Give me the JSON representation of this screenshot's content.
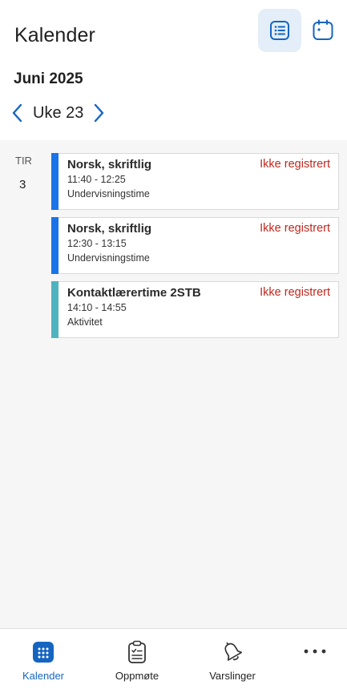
{
  "header": {
    "title": "Kalender",
    "month": "Juni 2025",
    "week": "Uke 23"
  },
  "day": {
    "name": "TIR",
    "number": "3"
  },
  "events": [
    {
      "title": "Norsk, skriftlig",
      "time": "11:40 - 12:25",
      "kind": "Undervisningstime",
      "status": "Ikke registrert",
      "color": "#1a73e8"
    },
    {
      "title": "Norsk, skriftlig",
      "time": "12:30 - 13:15",
      "kind": "Undervisningstime",
      "status": "Ikke registrert",
      "color": "#1a73e8"
    },
    {
      "title": "Kontaktlærertime 2STB",
      "time": "14:10 - 14:55",
      "kind": "Aktivitet",
      "status": "Ikke registrert",
      "color": "#4fb3bf"
    }
  ],
  "tabbar": {
    "tabs": [
      {
        "label": "Kalender",
        "icon": "calendar-icon",
        "active": true
      },
      {
        "label": "Oppmøte",
        "icon": "clipboard-icon",
        "active": false
      },
      {
        "label": "Varslinger",
        "icon": "bell-icon",
        "active": false
      },
      {
        "label": "",
        "icon": "more-icon",
        "active": false
      }
    ]
  },
  "colors": {
    "accent": "#1565c0",
    "status": "#c1281e",
    "lesson": "#1a73e8",
    "activity": "#4fb3bf"
  }
}
